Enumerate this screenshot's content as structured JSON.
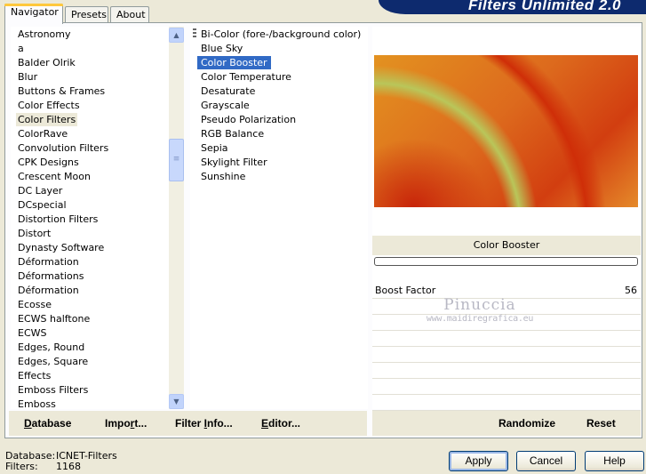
{
  "banner": {
    "title": "Filters Unlimited 2.0"
  },
  "tabs": [
    {
      "label": "Navigator"
    },
    {
      "label": "Presets"
    },
    {
      "label": "About"
    }
  ],
  "categories": [
    "Astronomy",
    "a",
    "Balder Olrik",
    "Blur",
    "Buttons & Frames",
    "Color Effects",
    "Color Filters",
    "ColorRave",
    "Convolution Filters",
    "CPK Designs",
    "Crescent Moon",
    "DC Layer",
    "DCspecial",
    "Distortion Filters",
    "Distort",
    "Dynasty Software",
    "Déformation",
    "Déformations",
    "Déformation",
    "Ecosse",
    "ECWS halftone",
    "ECWS",
    "Edges, Round",
    "Edges, Square",
    "Effects",
    "Emboss Filters",
    "Emboss"
  ],
  "selected_category": "Color Filters",
  "filters": [
    "Bi-Color (fore-/background color)",
    "Blue Sky",
    "Color Booster",
    "Color Temperature",
    "Desaturate",
    "Grayscale",
    "Pseudo Polarization",
    "RGB Balance",
    "Sepia",
    "Skylight Filter",
    "Sunshine"
  ],
  "selected_filter": "Color Booster",
  "effect_name": "Color Booster",
  "parameter": {
    "label": "Boost Factor",
    "value": "56"
  },
  "watermark": {
    "name": "Pinuccia",
    "url": "www.maidiregrafica.eu"
  },
  "left_bar": {
    "database": {
      "ul": "D",
      "rest": "atabase"
    },
    "import": {
      "pre": "Impo",
      "ul": "r",
      "post": "t..."
    },
    "filter_info": {
      "pre": "Filter ",
      "ul": "I",
      "post": "nfo..."
    },
    "editor": {
      "ul": "E",
      "rest": "ditor..."
    }
  },
  "right_bar": {
    "randomize": "Randomize",
    "reset": "Reset"
  },
  "status": {
    "database_label": "Database:",
    "database_value": "ICNET-Filters",
    "filters_label": "Filters:",
    "filters_value": "1168"
  },
  "buttons": {
    "apply": "Apply",
    "cancel": "Cancel",
    "help": "Help"
  },
  "colors": {
    "selection": "#316ac5",
    "banner": "#0d2a6e",
    "tab_highlight": "#ffc83c"
  }
}
